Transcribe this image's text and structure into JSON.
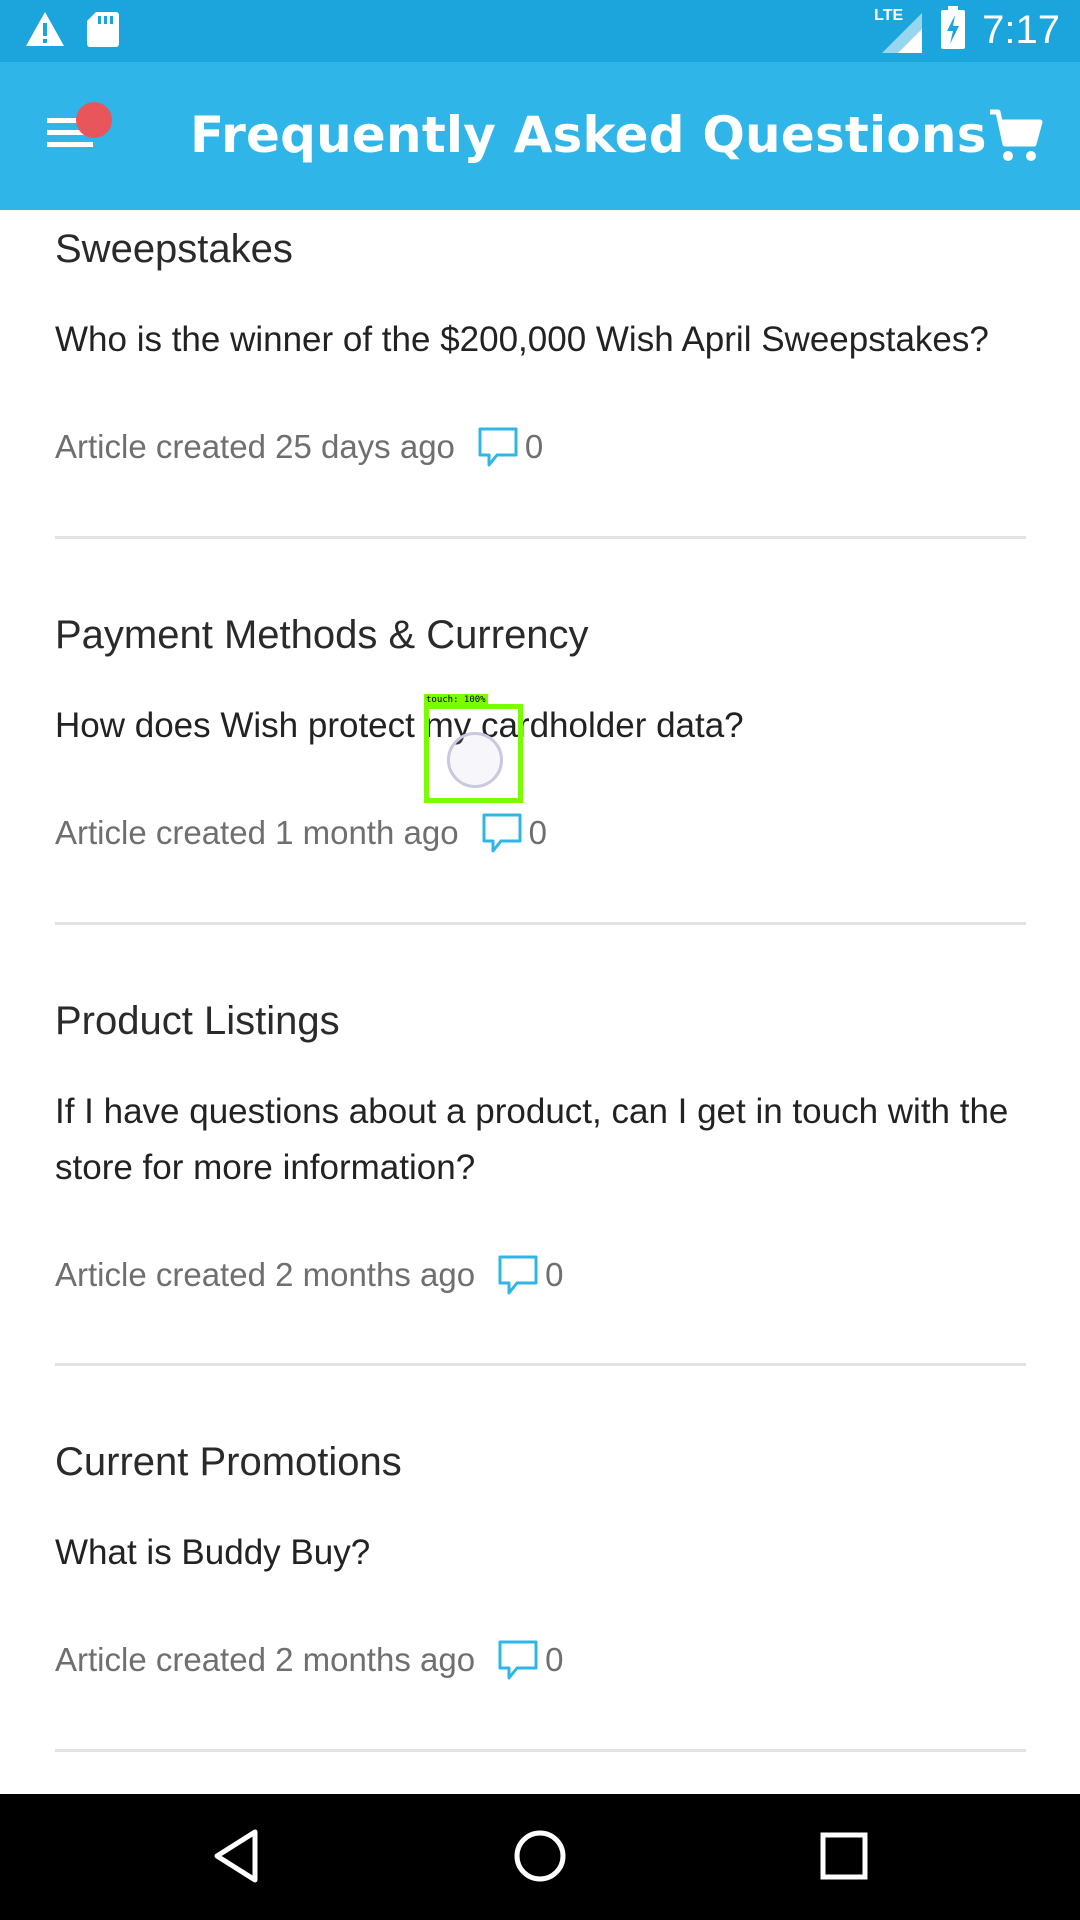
{
  "status_bar": {
    "time": "7:17",
    "network": "LTE",
    "icons": [
      "warning-icon",
      "sd-card-icon",
      "signal-icon",
      "battery-charging-icon"
    ]
  },
  "app_bar": {
    "title": "Frequently Asked Questions",
    "menu_icon": "menu-icon",
    "cart_icon": "cart-icon",
    "notification_dot_color": "#e8555a"
  },
  "colors": {
    "status_bar": "#1ba5dc",
    "app_bar": "#2fb5e8",
    "comment_icon": "#2fb5e8",
    "touch_indicator": "#7cfc00"
  },
  "articles": [
    {
      "category": "Sweepstakes",
      "question": "Who is the winner of the $200,000 Wish April Sweepstakes?",
      "meta": "Article created 25 days ago",
      "comments": "0"
    },
    {
      "category": "Payment Methods & Currency",
      "question": "How does Wish protect my cardholder data?",
      "meta": "Article created 1 month ago",
      "comments": "0"
    },
    {
      "category": "Product Listings",
      "question": "If I have questions about a product, can I get in touch with the store for more information?",
      "meta": "Article created 2 months ago",
      "comments": "0"
    },
    {
      "category": "Current Promotions",
      "question": "What is Buddy Buy?",
      "meta": "Article created 2 months ago",
      "comments": "0"
    }
  ],
  "touch_overlay": {
    "label": "touch: 100%"
  },
  "nav_bar": {
    "icons": [
      "back-icon",
      "home-icon",
      "recents-icon"
    ]
  }
}
